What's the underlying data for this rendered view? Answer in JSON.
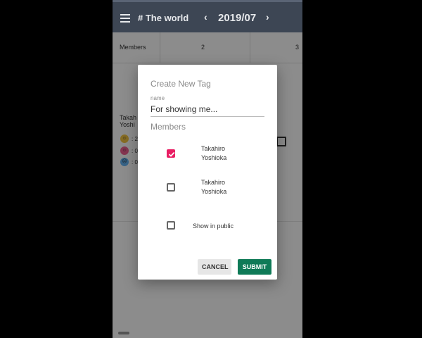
{
  "app_bar": {
    "title": "# The world",
    "month": "2019/07",
    "prev_icon": "chevron-left-icon",
    "next_icon": "chevron-right-icon",
    "menu_icon": "menu-icon",
    "bg_color": "#3d4654"
  },
  "background": {
    "grid_header": [
      "Members",
      "2",
      "3"
    ],
    "member_name_partial": [
      "Takah",
      "Yoshi"
    ],
    "reactions": [
      {
        "icon": "smiling-face-icon",
        "color": "#f4c542",
        "count": ": 2"
      },
      {
        "icon": "neutral-face-icon",
        "color": "#f06292",
        "count": ": 0"
      },
      {
        "icon": "sad-face-icon",
        "color": "#64b5f6",
        "count": ": 0"
      }
    ],
    "external_link_icon": "open-in-new-icon"
  },
  "dialog": {
    "title": "Create New Tag",
    "name_label": "name",
    "name_value": "For showing me...",
    "members_heading": "Members",
    "members": [
      {
        "first": "Takahiro",
        "last": "Yoshioka",
        "checked": true
      },
      {
        "first": "Takahiro",
        "last": "Yoshioka",
        "checked": false
      }
    ],
    "public_label": "Show in public",
    "public_checked": false,
    "cancel_label": "CANCEL",
    "submit_label": "SUBMIT",
    "accent_color": "#e91e63",
    "submit_color": "#0f7a57"
  }
}
